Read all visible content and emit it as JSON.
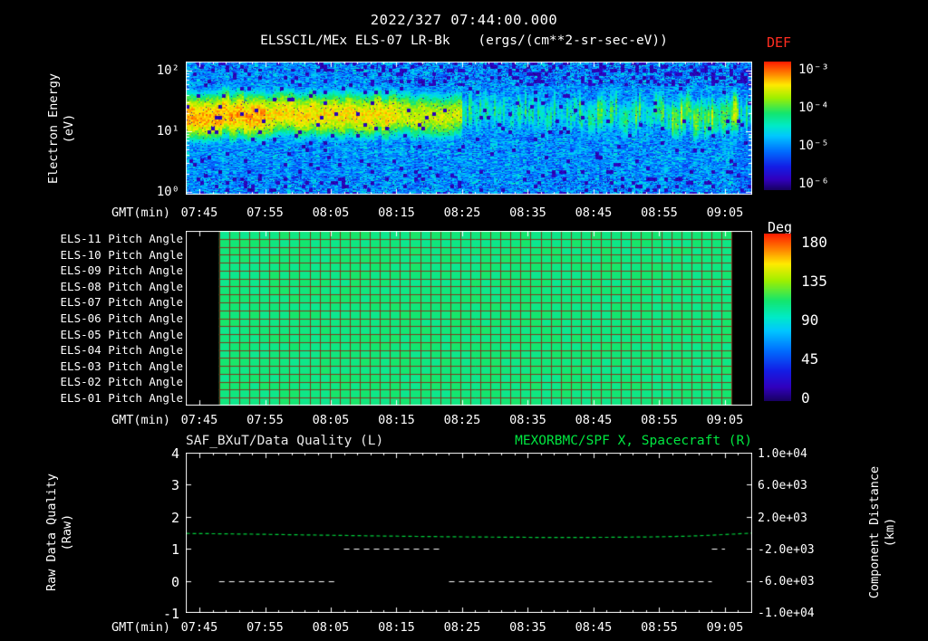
{
  "header": {
    "datetime": "2022/327 07:44:00.000",
    "instrument": "ELSSCIL/MEx ELS-07 LR-Bk",
    "units": "(ergs/(cm**2-sr-sec-eV))",
    "def_label": "DEF"
  },
  "colors": {
    "background": "#000000",
    "frame": "#ffffff",
    "def_title_red": "#ff2d20",
    "spacecraft_title_green": "#00e640",
    "distance_line_green": "#00d23c",
    "quality_line_white": "#ffffff"
  },
  "time_axis": {
    "label": "GMT(min)",
    "ticks": [
      "07:45",
      "07:55",
      "08:05",
      "08:15",
      "08:25",
      "08:35",
      "08:45",
      "08:55",
      "09:05"
    ]
  },
  "spectro": {
    "ylabel1": "Electron Energy",
    "ylabel2": "(eV)",
    "yticks": [
      "10²",
      "10¹",
      "10⁰"
    ],
    "cb_ticks": [
      "10⁻³",
      "10⁻⁴",
      "10⁻⁵",
      "10⁻⁶"
    ]
  },
  "pitch": {
    "rows": [
      "ELS-11 Pitch Angle",
      "ELS-10 Pitch Angle",
      "ELS-09 Pitch Angle",
      "ELS-08 Pitch Angle",
      "ELS-07 Pitch Angle",
      "ELS-06 Pitch Angle",
      "ELS-05 Pitch Angle",
      "ELS-04 Pitch Angle",
      "ELS-03 Pitch Angle",
      "ELS-02 Pitch Angle",
      "ELS-01 Pitch Angle"
    ],
    "cb_title": "Deg",
    "cb_ticks": [
      "180",
      "135",
      "90",
      "45",
      "0"
    ]
  },
  "bottom": {
    "title_left": "SAF_BXuT/Data Quality (L)",
    "title_right": "MEXORBMC/SPF X, Spacecraft (R)",
    "ylabel_left1": "Raw Data Quality",
    "ylabel_left2": "(Raw)",
    "ylabel_right1": "Component Distance",
    "ylabel_right2": "(km)",
    "left_ticks": [
      "4",
      "3",
      "2",
      "1",
      "0",
      "-1"
    ],
    "right_ticks": [
      "1.0e+04",
      "6.0e+03",
      "2.0e+03",
      "-2.0e+03",
      "-6.0e+03",
      "-1.0e+04"
    ]
  },
  "chart_data": [
    {
      "type": "heatmap",
      "panel": "electron-energy-spectrogram",
      "title": "ELSSCIL/MEx ELS-07 LR-Bk",
      "units": "ergs/(cm**2-sr-sec-eV)",
      "xlabel": "GMT(min)",
      "ylabel": "Electron Energy (eV)",
      "x_range_gmt": [
        "07:43",
        "09:09"
      ],
      "x_ticks": [
        "07:45",
        "07:55",
        "08:05",
        "08:15",
        "08:25",
        "08:35",
        "08:45",
        "08:55",
        "09:05"
      ],
      "y_scale": "log",
      "y_range_ev": [
        0.9,
        140
      ],
      "y_ticks_ev": [
        1,
        10,
        100
      ],
      "colorbar": {
        "title": "DEF",
        "scale": "log",
        "tick_labels": [
          "10⁻³",
          "10⁻⁴",
          "10⁻⁵",
          "10⁻⁶"
        ],
        "top_value": 0.001,
        "bottom_value": 1e-06
      },
      "features": {
        "background_logflux": -5.25,
        "band_center_ev": 19,
        "band_sigma_decades": 0.22,
        "segments": [
          {
            "t0": "07:43",
            "t1": "07:55",
            "peak_logflux": -3.35
          },
          {
            "t0": "07:55",
            "t1": "08:15",
            "peak_logflux": -3.55
          },
          {
            "t0": "08:15",
            "t1": "08:25",
            "peak_logflux": -3.75
          },
          {
            "t0": "08:25",
            "t1": "08:44",
            "peak_logflux": -4.7
          },
          {
            "t0": "08:44",
            "t1": "08:57",
            "peak_logflux": -4.55
          },
          {
            "t0": "08:57",
            "t1": "09:07",
            "peak_logflux": -4.2
          },
          {
            "t0": "09:07",
            "t1": "09:10",
            "peak_logflux": -4.7
          }
        ]
      }
    },
    {
      "type": "heatmap",
      "panel": "pitch-angle",
      "rows": [
        "ELS-11 Pitch Angle",
        "ELS-10 Pitch Angle",
        "ELS-09 Pitch Angle",
        "ELS-08 Pitch Angle",
        "ELS-07 Pitch Angle",
        "ELS-06 Pitch Angle",
        "ELS-05 Pitch Angle",
        "ELS-04 Pitch Angle",
        "ELS-03 Pitch Angle",
        "ELS-02 Pitch Angle",
        "ELS-01 Pitch Angle"
      ],
      "value_deg": 105,
      "data_gmt_range": [
        "07:48",
        "09:06"
      ],
      "x_ticks": [
        "07:45",
        "07:55",
        "08:05",
        "08:15",
        "08:25",
        "08:35",
        "08:45",
        "08:55",
        "09:05"
      ],
      "colorbar": {
        "title": "Deg",
        "range": [
          0,
          180
        ],
        "ticks": [
          180,
          135,
          90,
          45,
          0
        ]
      }
    },
    {
      "type": "line",
      "panel": "data-quality-and-spacecraft-position",
      "title_left": "SAF_BXuT/Data Quality (L)",
      "title_right": "MEXORBMC/SPF X, Spacecraft (R)",
      "xlabel": "GMT(min)",
      "x_ticks": [
        "07:45",
        "07:55",
        "08:05",
        "08:15",
        "08:25",
        "08:35",
        "08:45",
        "08:55",
        "09:05"
      ],
      "left_axis": {
        "label": "Raw Data Quality (Raw)",
        "range": [
          -1,
          4
        ],
        "ticks": [
          4,
          3,
          2,
          1,
          0,
          -1
        ]
      },
      "right_axis": {
        "label": "Component Distance (km)",
        "range": [
          -10000,
          10000
        ],
        "ticks": [
          10000,
          6000,
          2000,
          -2000,
          -6000,
          -10000
        ]
      },
      "series": [
        {
          "name": "SAF_BXuT/Data Quality",
          "axis": "left",
          "style": "dashed white",
          "segments": [
            {
              "value": 0,
              "t0": "07:48",
              "t1": "08:06"
            },
            {
              "value": 1,
              "t0": "08:07",
              "t1": "08:22"
            },
            {
              "value": 0,
              "t0": "08:23",
              "t1": "09:03"
            },
            {
              "value": 1,
              "t0": "09:03",
              "t1": "09:05"
            }
          ]
        },
        {
          "name": "MEXORBMC/SPF X Spacecraft",
          "axis": "right",
          "style": "dashed green",
          "points": [
            [
              "07:43",
              -80
            ],
            [
              "07:48",
              -120
            ],
            [
              "07:54",
              -180
            ],
            [
              "08:00",
              -250
            ],
            [
              "08:06",
              -320
            ],
            [
              "08:12",
              -390
            ],
            [
              "08:18",
              -450
            ],
            [
              "08:24",
              -500
            ],
            [
              "08:30",
              -540
            ],
            [
              "08:36",
              -570
            ],
            [
              "08:42",
              -580
            ],
            [
              "08:48",
              -560
            ],
            [
              "08:54",
              -510
            ],
            [
              "08:59",
              -430
            ],
            [
              "09:03",
              -300
            ],
            [
              "09:06",
              -170
            ],
            [
              "09:09",
              -40
            ]
          ]
        }
      ]
    }
  ]
}
